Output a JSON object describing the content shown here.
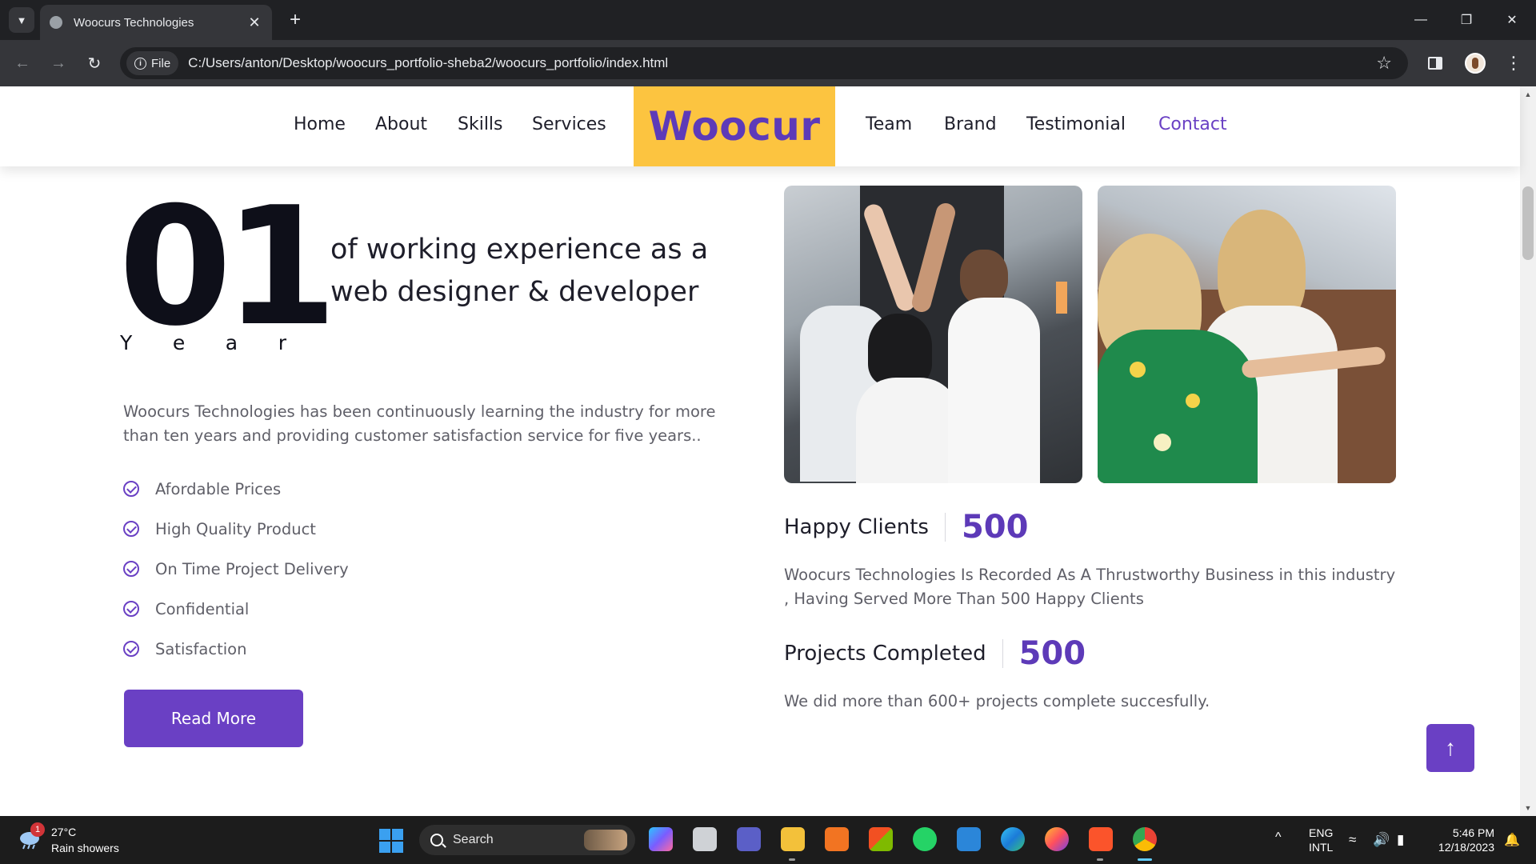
{
  "browser": {
    "tab_title": "Woocurs Technologies",
    "file_chip": "File",
    "url": "C:/Users/anton/Desktop/woocurs_portfolio-sheba2/woocurs_portfolio/index.html"
  },
  "site": {
    "nav_left": [
      "Home",
      "About",
      "Skills",
      "Services"
    ],
    "logo": "Woocur",
    "nav_right": [
      "Team",
      "Brand",
      "Testimonial",
      "Contact"
    ],
    "active_nav": "Contact"
  },
  "about": {
    "years_number": "01",
    "years_label": [
      "Y",
      "e",
      "a",
      "r"
    ],
    "experience_heading": "of working experience as a web designer & developer",
    "intro": "Woocurs Technologies has been continuously learning the industry for more than ten years and providing customer satisfaction service for five years..",
    "features": [
      "Afordable Prices",
      "High Quality Product",
      "On Time Project Delivery",
      "Confidential",
      "Satisfaction"
    ],
    "read_more": "Read More"
  },
  "stats": [
    {
      "label": "Happy Clients",
      "value": "500",
      "description": "Woocurs Technologies Is Recorded As A Thrustworthy Business in this industry , Having Served More Than 500 Happy Clients"
    },
    {
      "label": "Projects Completed",
      "value": "500",
      "description": "We did more than 600+ projects complete succesfully."
    }
  ],
  "taskbar": {
    "weather_badge": "1",
    "weather_temp": "27°C",
    "weather_desc": "Rain showers",
    "search_label": "Search",
    "lang_top": "ENG",
    "lang_bottom": "INTL",
    "time": "5:46 PM",
    "date": "12/18/2023"
  },
  "colors": {
    "brand_purple": "#6a40c4",
    "logo_yellow": "#fcc440"
  }
}
